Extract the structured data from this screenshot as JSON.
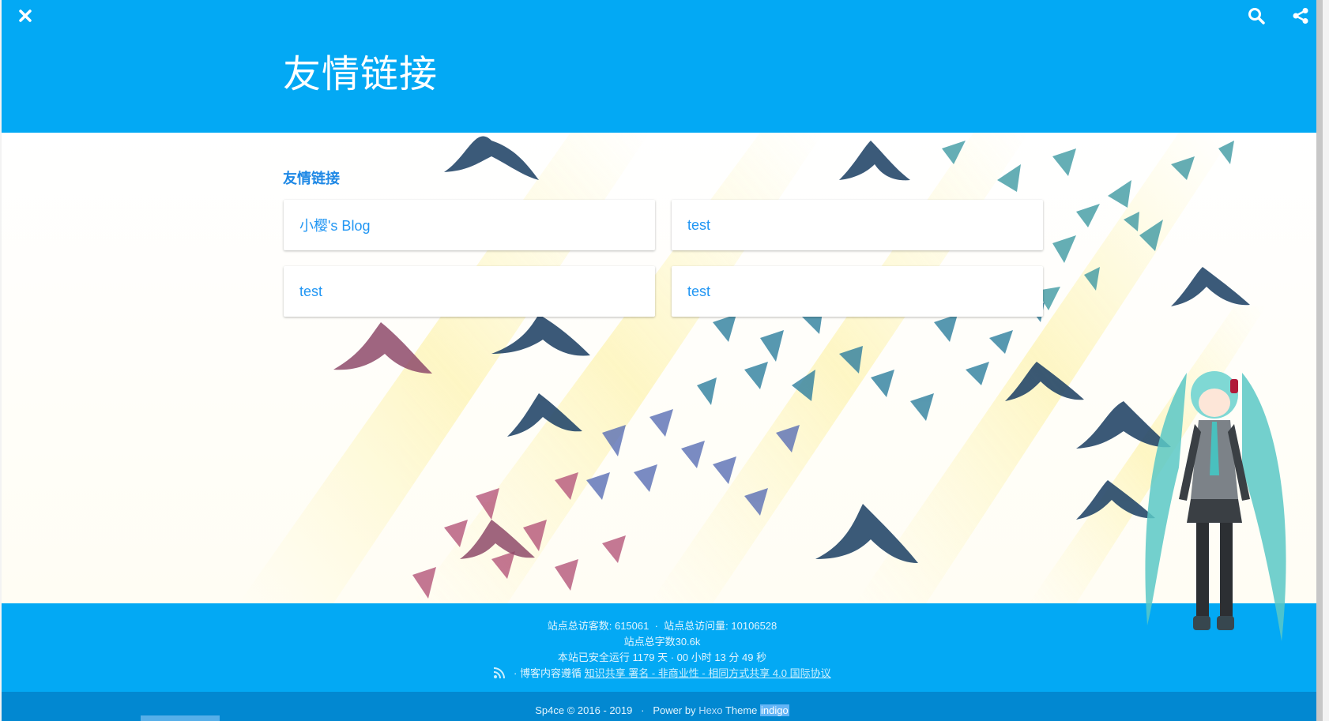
{
  "header": {
    "title": "友情链接",
    "close_icon": "close-icon",
    "search_icon": "search-icon",
    "share_icon": "share-icon"
  },
  "section": {
    "title": "友情链接"
  },
  "links": [
    {
      "label": "小樱's Blog"
    },
    {
      "label": "test"
    },
    {
      "label": "test"
    },
    {
      "label": "test"
    }
  ],
  "footer": {
    "visitors_label": "站点总访客数:",
    "visitors_value": "615061",
    "sep": "·",
    "pv_label": "站点总访问量:",
    "pv_value": "10106528",
    "words": "站点总字数30.6k",
    "runtime": "本站已安全运行 1179 天 · 00 小时 13 分 49 秒",
    "license_prefix": "· 博客内容遵循",
    "license_link": "知识共享 署名 - 非商业性 - 相同方式共享 4.0 国际协议",
    "rss_icon": "rss-icon"
  },
  "subfooter": {
    "copyright": "Sp4ce © 2016 - 2019",
    "sep": "·",
    "power_prefix": "Power by",
    "hexo": "Hexo",
    "theme_prefix": "Theme",
    "theme": "indigo"
  },
  "colors": {
    "primary": "#03a9f4",
    "primary_dark": "#0288d1",
    "link": "#2196f3"
  }
}
